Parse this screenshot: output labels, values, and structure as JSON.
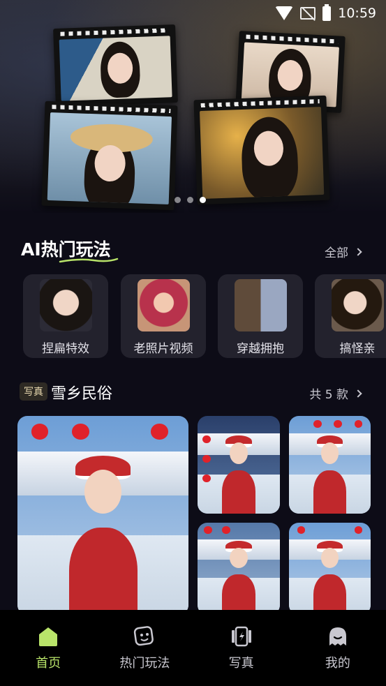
{
  "status_bar": {
    "time": "10:59",
    "icons": [
      "wifi-icon",
      "no-sim-icon",
      "battery-charging-icon"
    ]
  },
  "banner": {
    "carousel_total": 3,
    "carousel_active_index": 2
  },
  "ai_section": {
    "title": "AI热门玩法",
    "more_label": "全部",
    "items": [
      {
        "label": "捏扁特效"
      },
      {
        "label": "老照片视频"
      },
      {
        "label": "穿越拥抱"
      },
      {
        "label": "搞怪亲"
      }
    ]
  },
  "photo_section": {
    "tag": "写真",
    "title": "雪乡民俗",
    "count_label": "共 5 款"
  },
  "bottom_nav": {
    "active_index": 0,
    "active_color": "#b9e46a",
    "items": [
      {
        "label": "首页",
        "icon": "home-icon"
      },
      {
        "label": "热门玩法",
        "icon": "sticker-icon"
      },
      {
        "label": "写真",
        "icon": "photo-cards-icon"
      },
      {
        "label": "我的",
        "icon": "profile-ghost-icon"
      }
    ]
  }
}
